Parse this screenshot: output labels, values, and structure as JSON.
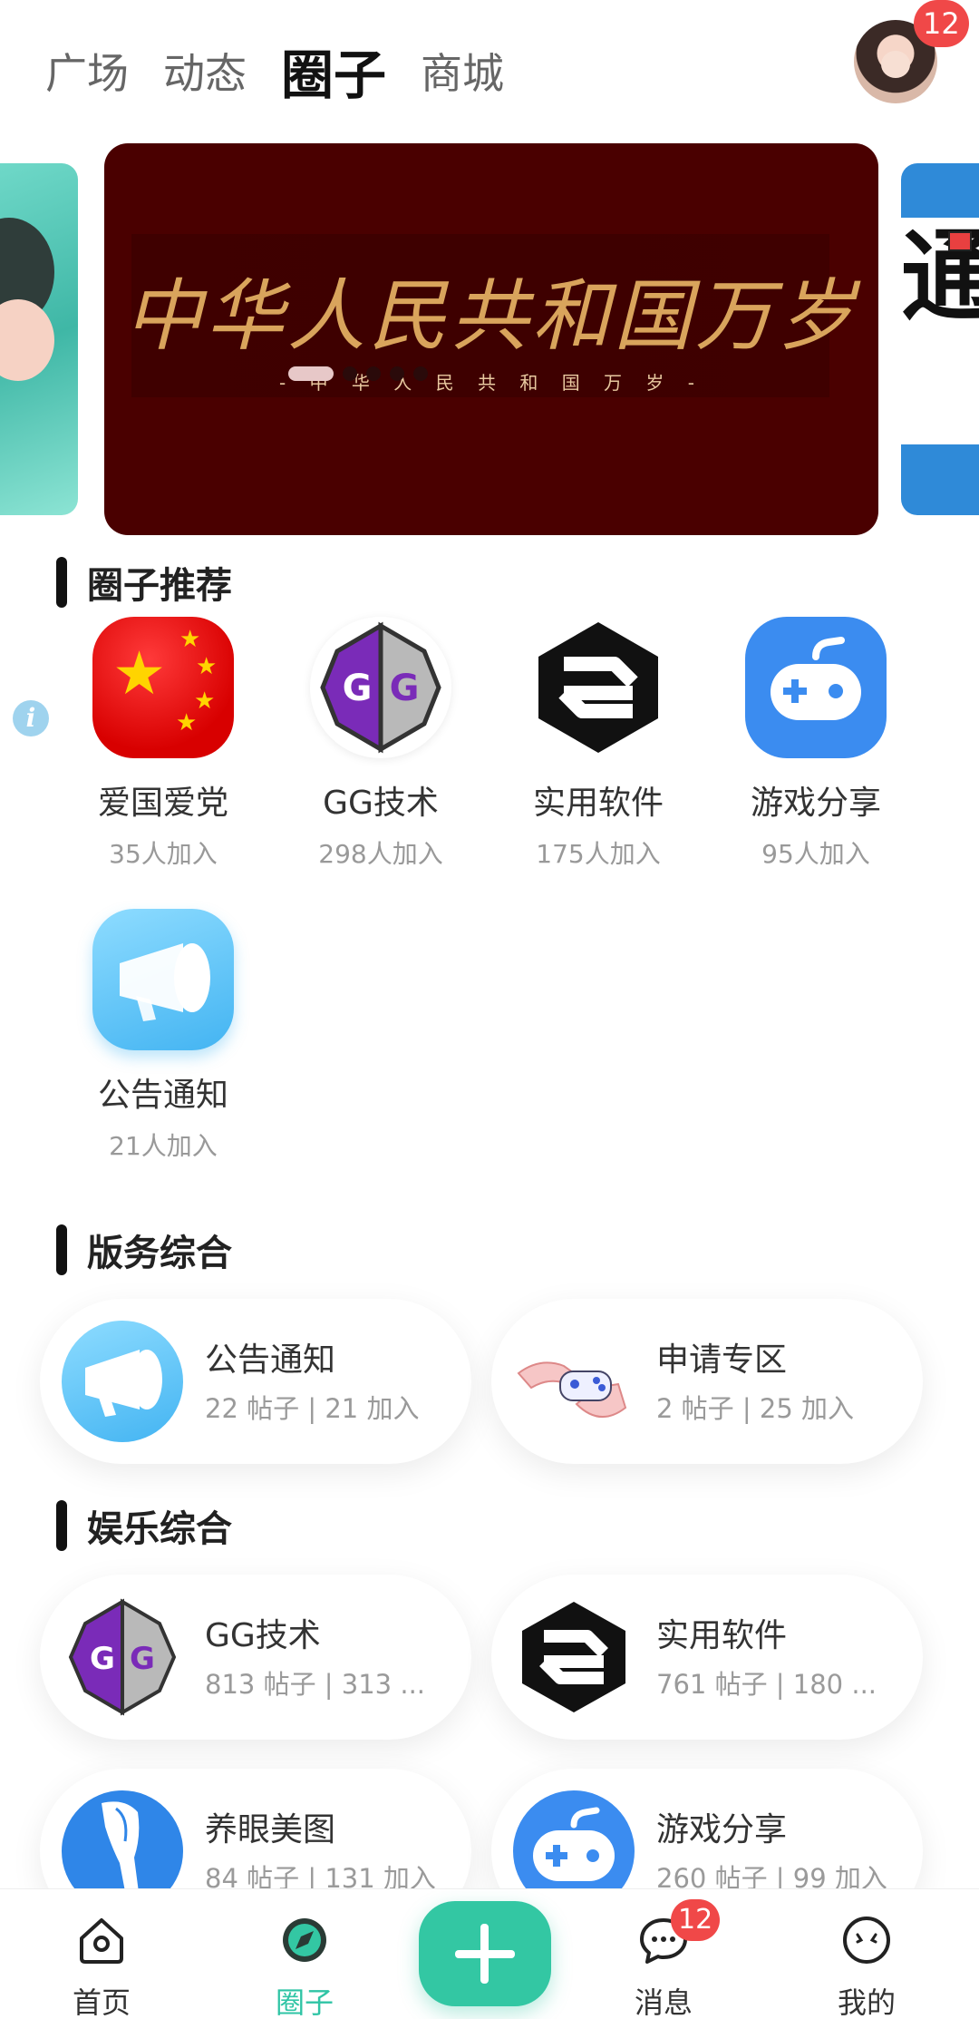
{
  "top_tabs": [
    {
      "label": "广场"
    },
    {
      "label": "动态"
    },
    {
      "label": "圈子"
    },
    {
      "label": "商城"
    }
  ],
  "avatar": {
    "badge": "12"
  },
  "banner": {
    "title": "中华人民共和国万岁",
    "subtitle": "- 中 华 人 民 共 和 国 万 岁 -",
    "slide_count": 5,
    "active_slide": 1
  },
  "recommend": {
    "title": "圈子推荐",
    "items": [
      {
        "name": "爱国爱党",
        "count": "35人加入",
        "icon": "china-flag-icon"
      },
      {
        "name": "GG技术",
        "count": "298人加入",
        "icon": "gg-logo-icon"
      },
      {
        "name": "实用软件",
        "count": "175人加入",
        "icon": "s-logo-icon"
      },
      {
        "name": "游戏分享",
        "count": "95人加入",
        "icon": "gamepad-icon"
      },
      {
        "name": "公告通知",
        "count": "21人加入",
        "icon": "megaphone-icon"
      }
    ]
  },
  "service": {
    "title": "版务综合",
    "cards": [
      {
        "title": "公告通知",
        "meta": "22 帖子 | 21 加入",
        "icon": "megaphone-icon"
      },
      {
        "title": "申请专区",
        "meta": "2 帖子 | 25 加入",
        "icon": "hands-controller-icon"
      }
    ]
  },
  "entertainment": {
    "title": "娱乐综合",
    "cards": [
      {
        "title": "GG技术",
        "meta": "813 帖子 | 313 ...",
        "icon": "gg-logo-icon"
      },
      {
        "title": "实用软件",
        "meta": "761 帖子 | 180 ...",
        "icon": "s-logo-icon"
      },
      {
        "title": "养眼美图",
        "meta": "84 帖子 | 131 加入",
        "icon": "legs-icon"
      },
      {
        "title": "游戏分享",
        "meta": "260 帖子 | 99 加入",
        "icon": "gamepad-icon"
      }
    ]
  },
  "bottom_nav": {
    "items": [
      {
        "label": "首页",
        "icon": "home-icon"
      },
      {
        "label": "圈子",
        "icon": "compass-icon"
      },
      {
        "label": "消息",
        "icon": "chat-icon",
        "badge": "12"
      },
      {
        "label": "我的",
        "icon": "face-icon"
      }
    ],
    "active": "圈子"
  },
  "colors": {
    "accent": "#33c7a3",
    "badge": "#f04848",
    "banner_bg": "#4a0000"
  }
}
